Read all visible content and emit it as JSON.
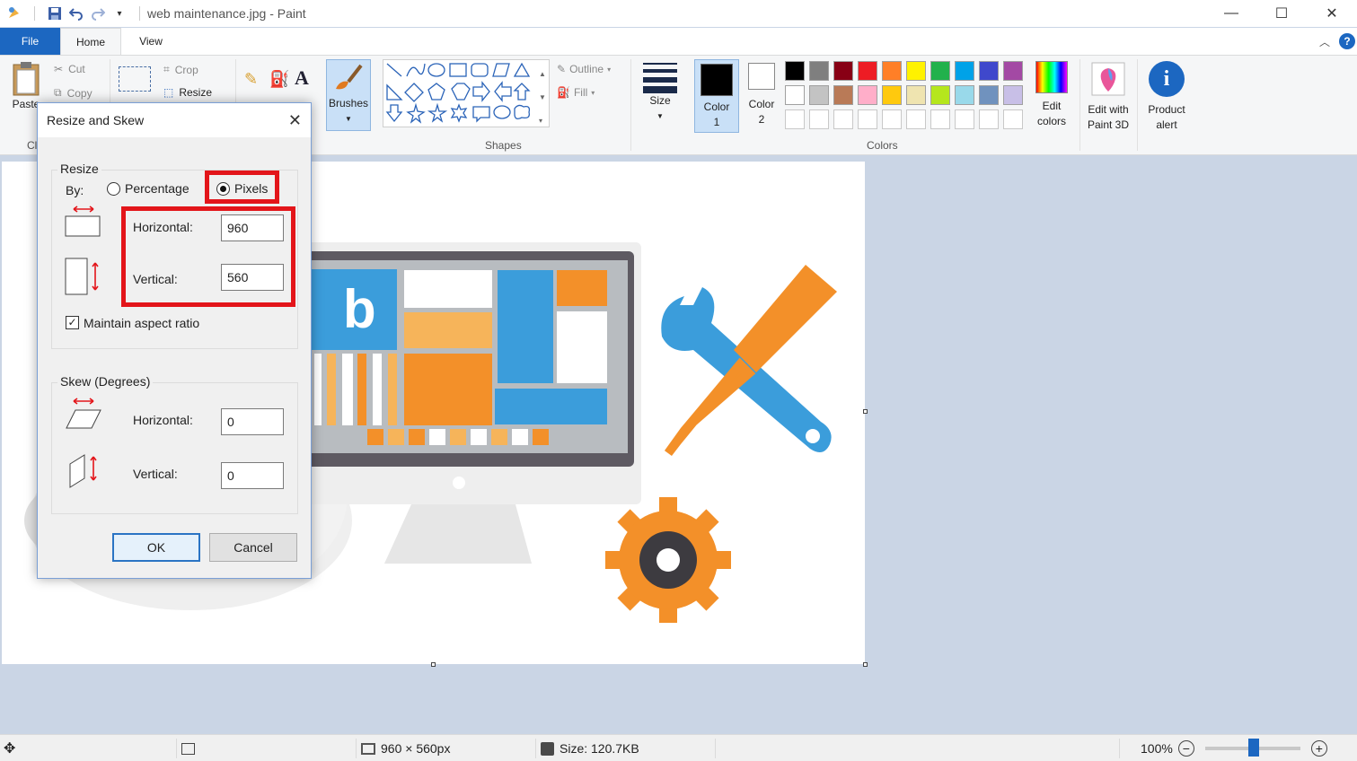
{
  "window": {
    "title": "web maintenance.jpg - Paint",
    "minimize": "—",
    "maximize": "☐",
    "close": "✕"
  },
  "tabs": {
    "file": "File",
    "home": "Home",
    "view": "View"
  },
  "ribbon": {
    "clipboard": {
      "paste": "Paste",
      "cut": "Cut",
      "copy": "Copy",
      "group": "Cl"
    },
    "image": {
      "crop": "Crop",
      "resize": "Resize"
    },
    "brushes": "Brushes",
    "shapes": {
      "group": "Shapes",
      "outline": "Outline",
      "fill": "Fill"
    },
    "size": "Size",
    "color1": {
      "line1": "Color",
      "line2": "1"
    },
    "color2": {
      "line1": "Color",
      "line2": "2"
    },
    "colors_group": "Colors",
    "edit_colors": {
      "line1": "Edit",
      "line2": "colors"
    },
    "paint3d": {
      "line1": "Edit with",
      "line2": "Paint 3D"
    },
    "product_alert": {
      "line1": "Product",
      "line2": "alert"
    },
    "palette_row1": [
      "#000000",
      "#7f7f7f",
      "#880015",
      "#ed1c24",
      "#ff7f27",
      "#fff200",
      "#22b14c",
      "#00a2e8",
      "#3f48cc",
      "#a349a4"
    ],
    "palette_row2": [
      "#ffffff",
      "#c3c3c3",
      "#b97a57",
      "#ffaec9",
      "#ffc90e",
      "#efe4b0",
      "#b5e61d",
      "#99d9ea",
      "#7092be",
      "#c8bfe7"
    ]
  },
  "dialog": {
    "title": "Resize and Skew",
    "resize_legend": "Resize",
    "by_label": "By:",
    "percentage": "Percentage",
    "pixels": "Pixels",
    "horizontal_label": "Horizontal:",
    "horizontal_value": "960",
    "vertical_label": "Vertical:",
    "vertical_value": "560",
    "maintain_aspect": "Maintain aspect ratio",
    "skew_legend": "Skew (Degrees)",
    "skew_horizontal_label": "Horizontal:",
    "skew_horizontal_value": "0",
    "skew_vertical_label": "Vertical:",
    "skew_vertical_value": "0",
    "ok": "OK",
    "cancel": "Cancel"
  },
  "status": {
    "dimensions": "960 × 560px",
    "size": "Size: 120.7KB",
    "zoom": "100%"
  },
  "colors": {
    "accent": "#1c67c1",
    "highlight": "#e3151a"
  }
}
